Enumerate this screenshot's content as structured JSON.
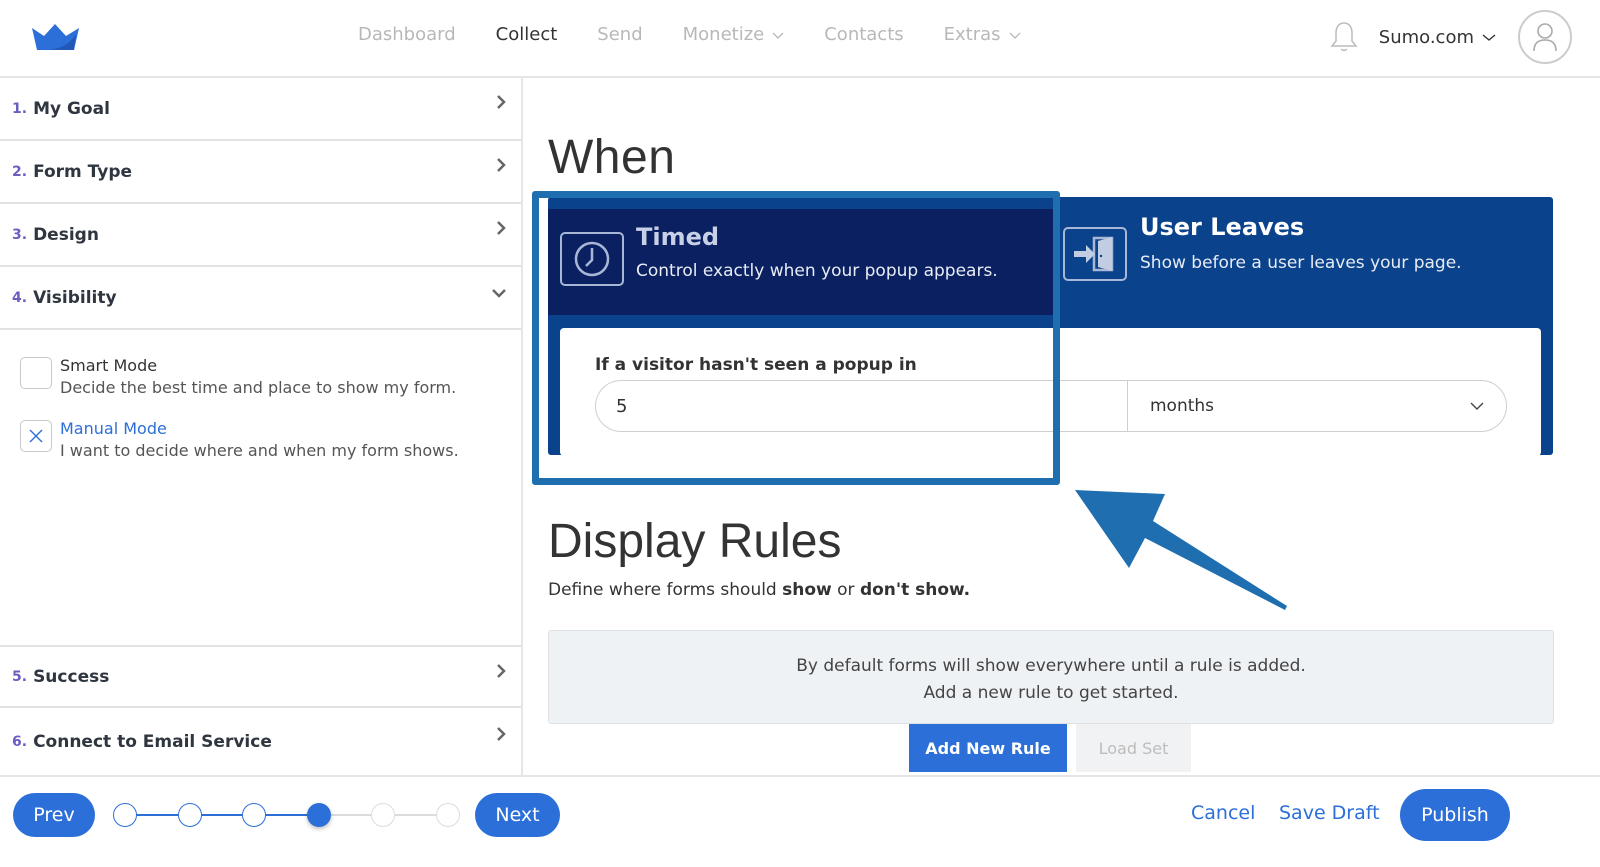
{
  "brand": {
    "logo": "crown-logo",
    "color": "#2c6fd8"
  },
  "nav": {
    "items": [
      {
        "label": "Dashboard",
        "active": false,
        "dropdown": false
      },
      {
        "label": "Collect",
        "active": true,
        "dropdown": false
      },
      {
        "label": "Send",
        "active": false,
        "dropdown": false
      },
      {
        "label": "Monetize",
        "active": false,
        "dropdown": true
      },
      {
        "label": "Contacts",
        "active": false,
        "dropdown": false
      },
      {
        "label": "Extras",
        "active": false,
        "dropdown": true
      }
    ],
    "account_label": "Sumo.com",
    "icons": {
      "notifications": "bell-icon",
      "avatar": "user-icon"
    }
  },
  "sidebar": {
    "steps": [
      {
        "num": "1.",
        "label": "My Goal",
        "state": "collapsed"
      },
      {
        "num": "2.",
        "label": "Form Type",
        "state": "collapsed"
      },
      {
        "num": "3.",
        "label": "Design",
        "state": "collapsed"
      },
      {
        "num": "4.",
        "label": "Visibility",
        "state": "expanded"
      },
      {
        "num": "5.",
        "label": "Success",
        "state": "collapsed"
      },
      {
        "num": "6.",
        "label": "Connect to Email Service",
        "state": "collapsed"
      }
    ],
    "modes": [
      {
        "title": "Smart Mode",
        "desc": "Decide the best time and place to show my form.",
        "selected": false
      },
      {
        "title": "Manual Mode",
        "desc": "I want to decide where and when my form shows.",
        "selected": true
      }
    ]
  },
  "when": {
    "title": "When",
    "triggers": [
      {
        "title": "Timed",
        "desc": "Control exactly when your popup appears.",
        "icon": "clock-icon",
        "selected": true
      },
      {
        "title": "User Leaves",
        "desc": "Show before a user leaves your page.",
        "icon": "exit-door-icon",
        "selected": false
      }
    ],
    "frequency": {
      "label": "If a visitor hasn't seen a popup in",
      "value": "5",
      "unit": "months"
    }
  },
  "display_rules": {
    "title": "Display Rules",
    "sub_prefix": "Define where forms should ",
    "sub_show": "show",
    "sub_or": " or ",
    "sub_dont": "don't show.",
    "empty_line1": "By default forms will show everywhere until a rule is added.",
    "empty_line2": "Add a new rule to get started.",
    "add_button": "Add New Rule",
    "load_button": "Load Set"
  },
  "footer": {
    "prev": "Prev",
    "next": "Next",
    "cancel": "Cancel",
    "save_draft": "Save Draft",
    "publish": "Publish",
    "progress": {
      "total_steps": 6,
      "current_step": 4
    }
  },
  "colors": {
    "primary": "#2c6fd8",
    "panel_dark": "#0a2060",
    "panel": "#0a428c",
    "annotation": "#1f6fb0",
    "step_number": "#6a5fc1"
  }
}
